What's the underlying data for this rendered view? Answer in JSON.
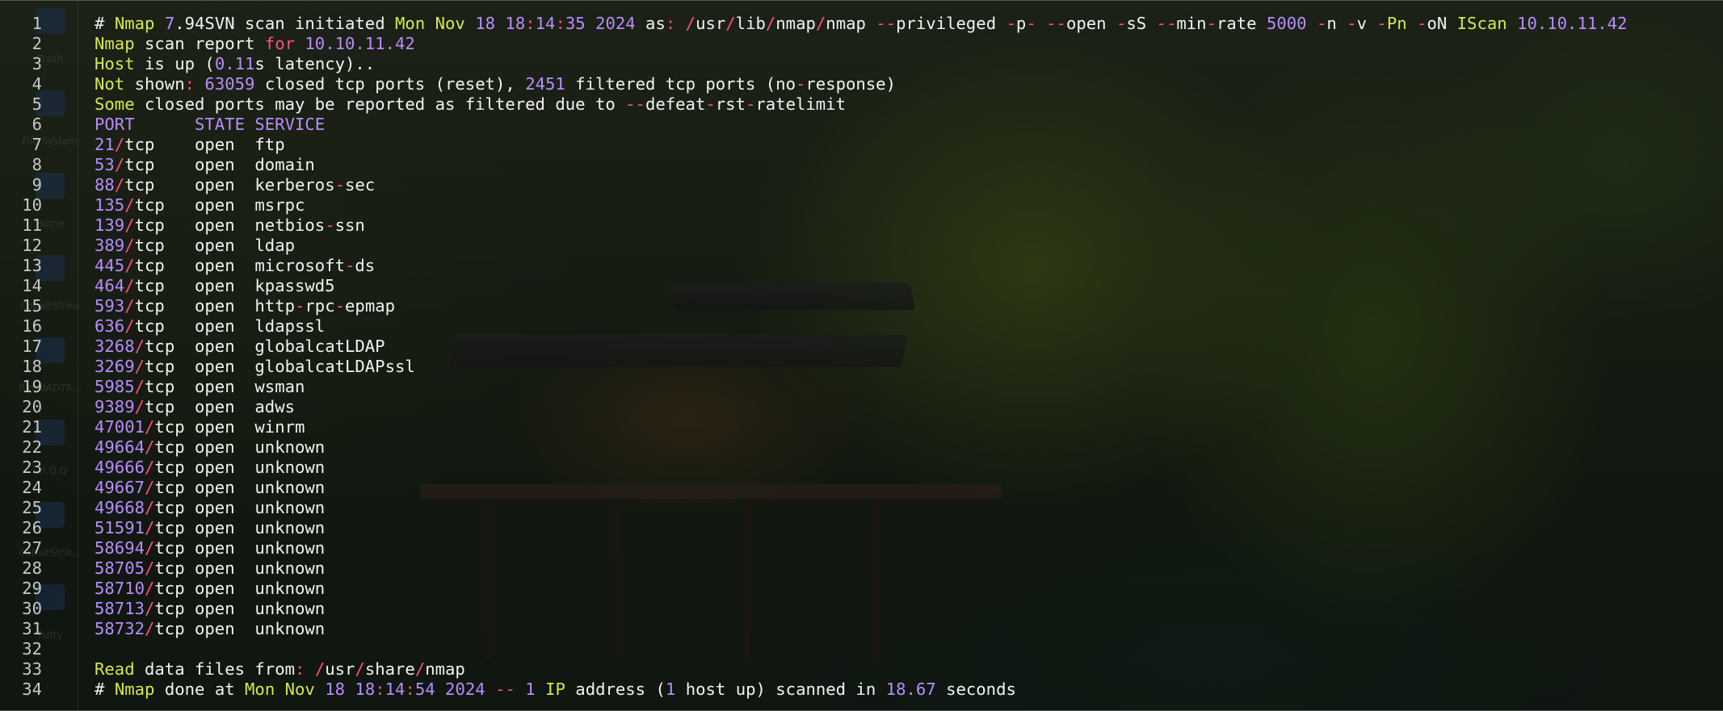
{
  "colors": {
    "keyword_yellow": "#d6e84a",
    "number_purple": "#b88cff",
    "operator_red": "#ff4f7a",
    "text_white": "#f2f2f2",
    "line_number": "#c8c8c8"
  },
  "desktop_icons": [
    {
      "label": "Trash",
      "icon": "trash-icon"
    },
    {
      "label": "File System",
      "icon": "drive-icon"
    },
    {
      "label": "Home",
      "icon": "home-folder-icon"
    },
    {
      "label": "CobaltStrike",
      "icon": "folder-icon"
    },
    {
      "label": "BloodADTR...",
      "icon": "app-icon"
    },
    {
      "label": "Ch.Q.Q",
      "icon": "app-icon"
    },
    {
      "label": "CobaltStrik...",
      "icon": "folder-icon"
    },
    {
      "label": "Putty",
      "icon": "folder-icon"
    }
  ],
  "editor": {
    "lines": [
      {
        "n": "1",
        "tokens": [
          [
            "w",
            "# "
          ],
          [
            "y",
            "Nmap"
          ],
          [
            "w",
            " "
          ],
          [
            "p",
            "7"
          ],
          [
            "w",
            ".94SVN scan initiated "
          ],
          [
            "y",
            "Mon Nov"
          ],
          [
            "w",
            " "
          ],
          [
            "p",
            "18 18"
          ],
          [
            "r",
            ":"
          ],
          [
            "p",
            "14"
          ],
          [
            "r",
            ":"
          ],
          [
            "p",
            "35 2024"
          ],
          [
            "w",
            " as"
          ],
          [
            "r",
            ":"
          ],
          [
            "w",
            " "
          ],
          [
            "r",
            "/"
          ],
          [
            "w",
            "usr"
          ],
          [
            "r",
            "/"
          ],
          [
            "w",
            "lib"
          ],
          [
            "r",
            "/"
          ],
          [
            "w",
            "nmap"
          ],
          [
            "r",
            "/"
          ],
          [
            "w",
            "nmap "
          ],
          [
            "r",
            "--"
          ],
          [
            "w",
            "privileged "
          ],
          [
            "r",
            "-"
          ],
          [
            "w",
            "p"
          ],
          [
            "r",
            "-"
          ],
          [
            "w",
            " "
          ],
          [
            "r",
            "--"
          ],
          [
            "w",
            "open "
          ],
          [
            "r",
            "-"
          ],
          [
            "w",
            "sS "
          ],
          [
            "r",
            "--"
          ],
          [
            "w",
            "min"
          ],
          [
            "r",
            "-"
          ],
          [
            "w",
            "rate "
          ],
          [
            "p",
            "5000"
          ],
          [
            "w",
            " "
          ],
          [
            "r",
            "-"
          ],
          [
            "w",
            "n "
          ],
          [
            "r",
            "-"
          ],
          [
            "w",
            "v "
          ],
          [
            "r",
            "-"
          ],
          [
            "y",
            "Pn"
          ],
          [
            "w",
            " "
          ],
          [
            "r",
            "-"
          ],
          [
            "w",
            "oN "
          ],
          [
            "y",
            "IScan"
          ],
          [
            "w",
            " "
          ],
          [
            "p",
            "10.10.11.42"
          ]
        ]
      },
      {
        "n": "2",
        "tokens": [
          [
            "y",
            "Nmap"
          ],
          [
            "w",
            " scan report "
          ],
          [
            "r",
            "for"
          ],
          [
            "w",
            " "
          ],
          [
            "p",
            "10.10.11.42"
          ]
        ]
      },
      {
        "n": "3",
        "tokens": [
          [
            "y",
            "Host"
          ],
          [
            "w",
            " is up ("
          ],
          [
            "p",
            "0.11"
          ],
          [
            "w",
            "s latency).."
          ]
        ]
      },
      {
        "n": "4",
        "tokens": [
          [
            "y",
            "Not"
          ],
          [
            "w",
            " shown"
          ],
          [
            "r",
            ":"
          ],
          [
            "w",
            " "
          ],
          [
            "p",
            "63059"
          ],
          [
            "w",
            " closed tcp ports (reset), "
          ],
          [
            "p",
            "2451"
          ],
          [
            "w",
            " filtered tcp ports (no"
          ],
          [
            "r",
            "-"
          ],
          [
            "w",
            "response)"
          ]
        ]
      },
      {
        "n": "5",
        "tokens": [
          [
            "y",
            "Some"
          ],
          [
            "w",
            " closed ports may be reported as filtered due to "
          ],
          [
            "r",
            "--"
          ],
          [
            "w",
            "defeat"
          ],
          [
            "r",
            "-"
          ],
          [
            "w",
            "rst"
          ],
          [
            "r",
            "-"
          ],
          [
            "w",
            "ratelimit"
          ]
        ]
      },
      {
        "n": "6",
        "tokens": [
          [
            "p",
            "PORT      STATE SERVICE"
          ]
        ]
      },
      {
        "n": "7",
        "tokens": [
          [
            "p",
            "21"
          ],
          [
            "r",
            "/"
          ],
          [
            "w",
            "tcp    open  ftp"
          ]
        ]
      },
      {
        "n": "8",
        "tokens": [
          [
            "p",
            "53"
          ],
          [
            "r",
            "/"
          ],
          [
            "w",
            "tcp    open  domain"
          ]
        ]
      },
      {
        "n": "9",
        "tokens": [
          [
            "p",
            "88"
          ],
          [
            "r",
            "/"
          ],
          [
            "w",
            "tcp    open  kerberos"
          ],
          [
            "r",
            "-"
          ],
          [
            "w",
            "sec"
          ]
        ]
      },
      {
        "n": "10",
        "tokens": [
          [
            "p",
            "135"
          ],
          [
            "r",
            "/"
          ],
          [
            "w",
            "tcp   open  msrpc"
          ]
        ]
      },
      {
        "n": "11",
        "tokens": [
          [
            "p",
            "139"
          ],
          [
            "r",
            "/"
          ],
          [
            "w",
            "tcp   open  netbios"
          ],
          [
            "r",
            "-"
          ],
          [
            "w",
            "ssn"
          ]
        ]
      },
      {
        "n": "12",
        "tokens": [
          [
            "p",
            "389"
          ],
          [
            "r",
            "/"
          ],
          [
            "w",
            "tcp   open  ldap"
          ]
        ]
      },
      {
        "n": "13",
        "tokens": [
          [
            "p",
            "445"
          ],
          [
            "r",
            "/"
          ],
          [
            "w",
            "tcp   open  microsoft"
          ],
          [
            "r",
            "-"
          ],
          [
            "w",
            "ds"
          ]
        ]
      },
      {
        "n": "14",
        "tokens": [
          [
            "p",
            "464"
          ],
          [
            "r",
            "/"
          ],
          [
            "w",
            "tcp   open  kpasswd5"
          ]
        ]
      },
      {
        "n": "15",
        "tokens": [
          [
            "p",
            "593"
          ],
          [
            "r",
            "/"
          ],
          [
            "w",
            "tcp   open  http"
          ],
          [
            "r",
            "-"
          ],
          [
            "w",
            "rpc"
          ],
          [
            "r",
            "-"
          ],
          [
            "w",
            "epmap"
          ]
        ]
      },
      {
        "n": "16",
        "tokens": [
          [
            "p",
            "636"
          ],
          [
            "r",
            "/"
          ],
          [
            "w",
            "tcp   open  ldapssl"
          ]
        ]
      },
      {
        "n": "17",
        "tokens": [
          [
            "p",
            "3268"
          ],
          [
            "r",
            "/"
          ],
          [
            "w",
            "tcp  open  globalcatLDAP"
          ]
        ]
      },
      {
        "n": "18",
        "tokens": [
          [
            "p",
            "3269"
          ],
          [
            "r",
            "/"
          ],
          [
            "w",
            "tcp  open  globalcatLDAPssl"
          ]
        ]
      },
      {
        "n": "19",
        "tokens": [
          [
            "p",
            "5985"
          ],
          [
            "r",
            "/"
          ],
          [
            "w",
            "tcp  open  wsman"
          ]
        ]
      },
      {
        "n": "20",
        "tokens": [
          [
            "p",
            "9389"
          ],
          [
            "r",
            "/"
          ],
          [
            "w",
            "tcp  open  adws"
          ]
        ]
      },
      {
        "n": "21",
        "tokens": [
          [
            "p",
            "47001"
          ],
          [
            "r",
            "/"
          ],
          [
            "w",
            "tcp open  winrm"
          ]
        ]
      },
      {
        "n": "22",
        "tokens": [
          [
            "p",
            "49664"
          ],
          [
            "r",
            "/"
          ],
          [
            "w",
            "tcp open  unknown"
          ]
        ]
      },
      {
        "n": "23",
        "tokens": [
          [
            "p",
            "49666"
          ],
          [
            "r",
            "/"
          ],
          [
            "w",
            "tcp open  unknown"
          ]
        ]
      },
      {
        "n": "24",
        "tokens": [
          [
            "p",
            "49667"
          ],
          [
            "r",
            "/"
          ],
          [
            "w",
            "tcp open  unknown"
          ]
        ]
      },
      {
        "n": "25",
        "tokens": [
          [
            "p",
            "49668"
          ],
          [
            "r",
            "/"
          ],
          [
            "w",
            "tcp open  unknown"
          ]
        ]
      },
      {
        "n": "26",
        "tokens": [
          [
            "p",
            "51591"
          ],
          [
            "r",
            "/"
          ],
          [
            "w",
            "tcp open  unknown"
          ]
        ]
      },
      {
        "n": "27",
        "tokens": [
          [
            "p",
            "58694"
          ],
          [
            "r",
            "/"
          ],
          [
            "w",
            "tcp open  unknown"
          ]
        ]
      },
      {
        "n": "28",
        "tokens": [
          [
            "p",
            "58705"
          ],
          [
            "r",
            "/"
          ],
          [
            "w",
            "tcp open  unknown"
          ]
        ]
      },
      {
        "n": "29",
        "tokens": [
          [
            "p",
            "58710"
          ],
          [
            "r",
            "/"
          ],
          [
            "w",
            "tcp open  unknown"
          ]
        ]
      },
      {
        "n": "30",
        "tokens": [
          [
            "p",
            "58713"
          ],
          [
            "r",
            "/"
          ],
          [
            "w",
            "tcp open  unknown"
          ]
        ]
      },
      {
        "n": "31",
        "tokens": [
          [
            "p",
            "58732"
          ],
          [
            "r",
            "/"
          ],
          [
            "w",
            "tcp open  unknown"
          ]
        ]
      },
      {
        "n": "32",
        "tokens": []
      },
      {
        "n": "33",
        "tokens": [
          [
            "y",
            "Read"
          ],
          [
            "w",
            " data files from"
          ],
          [
            "r",
            ":"
          ],
          [
            "w",
            " "
          ],
          [
            "r",
            "/"
          ],
          [
            "w",
            "usr"
          ],
          [
            "r",
            "/"
          ],
          [
            "w",
            "share"
          ],
          [
            "r",
            "/"
          ],
          [
            "w",
            "nmap"
          ]
        ]
      },
      {
        "n": "34",
        "tokens": [
          [
            "w",
            "# "
          ],
          [
            "y",
            "Nmap"
          ],
          [
            "w",
            " done at "
          ],
          [
            "y",
            "Mon Nov"
          ],
          [
            "w",
            " "
          ],
          [
            "p",
            "18 18"
          ],
          [
            "r",
            ":"
          ],
          [
            "p",
            "14"
          ],
          [
            "r",
            ":"
          ],
          [
            "p",
            "54 2024"
          ],
          [
            "w",
            " "
          ],
          [
            "r",
            "--"
          ],
          [
            "w",
            " "
          ],
          [
            "p",
            "1"
          ],
          [
            "w",
            " "
          ],
          [
            "y",
            "IP"
          ],
          [
            "w",
            " address ("
          ],
          [
            "p",
            "1"
          ],
          [
            "w",
            " host up) scanned in "
          ],
          [
            "p",
            "18.67"
          ],
          [
            "w",
            " seconds"
          ]
        ]
      }
    ]
  }
}
